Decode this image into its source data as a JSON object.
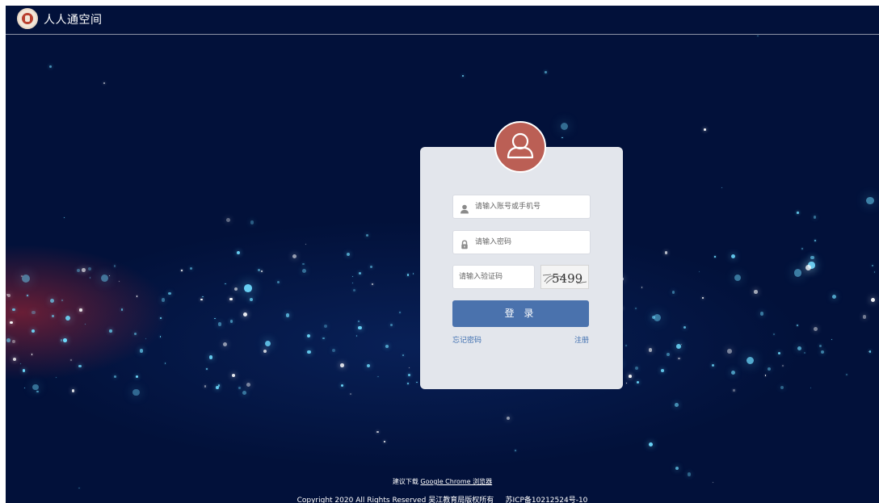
{
  "header": {
    "site_title": "人人通空间",
    "logo_icon": "school-seal-logo"
  },
  "login": {
    "avatar_icon": "user-avatar-icon",
    "account_placeholder": "请输入账号或手机号",
    "password_placeholder": "请输入密码",
    "captcha_placeholder": "请输入验证码",
    "captcha_text": "5499",
    "login_label": "登 录",
    "forgot_label": "忘记密码",
    "register_label": "注册"
  },
  "footer": {
    "tip_prefix": "建议下载",
    "tip_link": "Google Chrome 浏览器",
    "copyright": "Copyright 2020 All Rights Reserved 吴江教育局版权所有",
    "icp": "苏ICP备10212524号-10"
  },
  "colors": {
    "background": "#02113a",
    "card": "#e3e6ec",
    "avatar": "#bb5f55",
    "button": "#4a72ad",
    "link": "#3f6fb0"
  }
}
